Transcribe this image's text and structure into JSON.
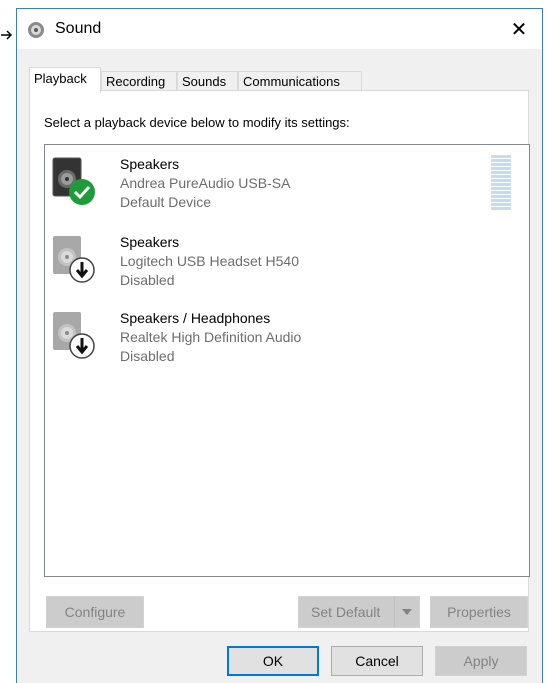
{
  "window": {
    "title": "Sound",
    "close_glyph": "✕"
  },
  "tabs": [
    {
      "label": "Playback",
      "active": true
    },
    {
      "label": "Recording",
      "active": false
    },
    {
      "label": "Sounds",
      "active": false
    },
    {
      "label": "Communications",
      "active": false
    }
  ],
  "playback": {
    "instruction": "Select a playback device below to modify its settings:",
    "devices": [
      {
        "name": "Speakers",
        "description": "Andrea PureAudio USB-SA",
        "status": "Default Device",
        "badge": "check-icon"
      },
      {
        "name": "Speakers",
        "description": "Logitech USB Headset H540",
        "status": "Disabled",
        "badge": "down-arrow-icon"
      },
      {
        "name": "Speakers / Headphones",
        "description": "Realtek High Definition Audio",
        "status": "Disabled",
        "badge": "down-arrow-icon"
      }
    ]
  },
  "buttons": {
    "configure": "Configure",
    "set_default": "Set Default",
    "properties": "Properties",
    "ok": "OK",
    "cancel": "Cancel",
    "apply": "Apply"
  },
  "colors": {
    "accent": "#0078d7",
    "default_badge": "#1e9c3a",
    "level_meter": "#c8dcef"
  }
}
